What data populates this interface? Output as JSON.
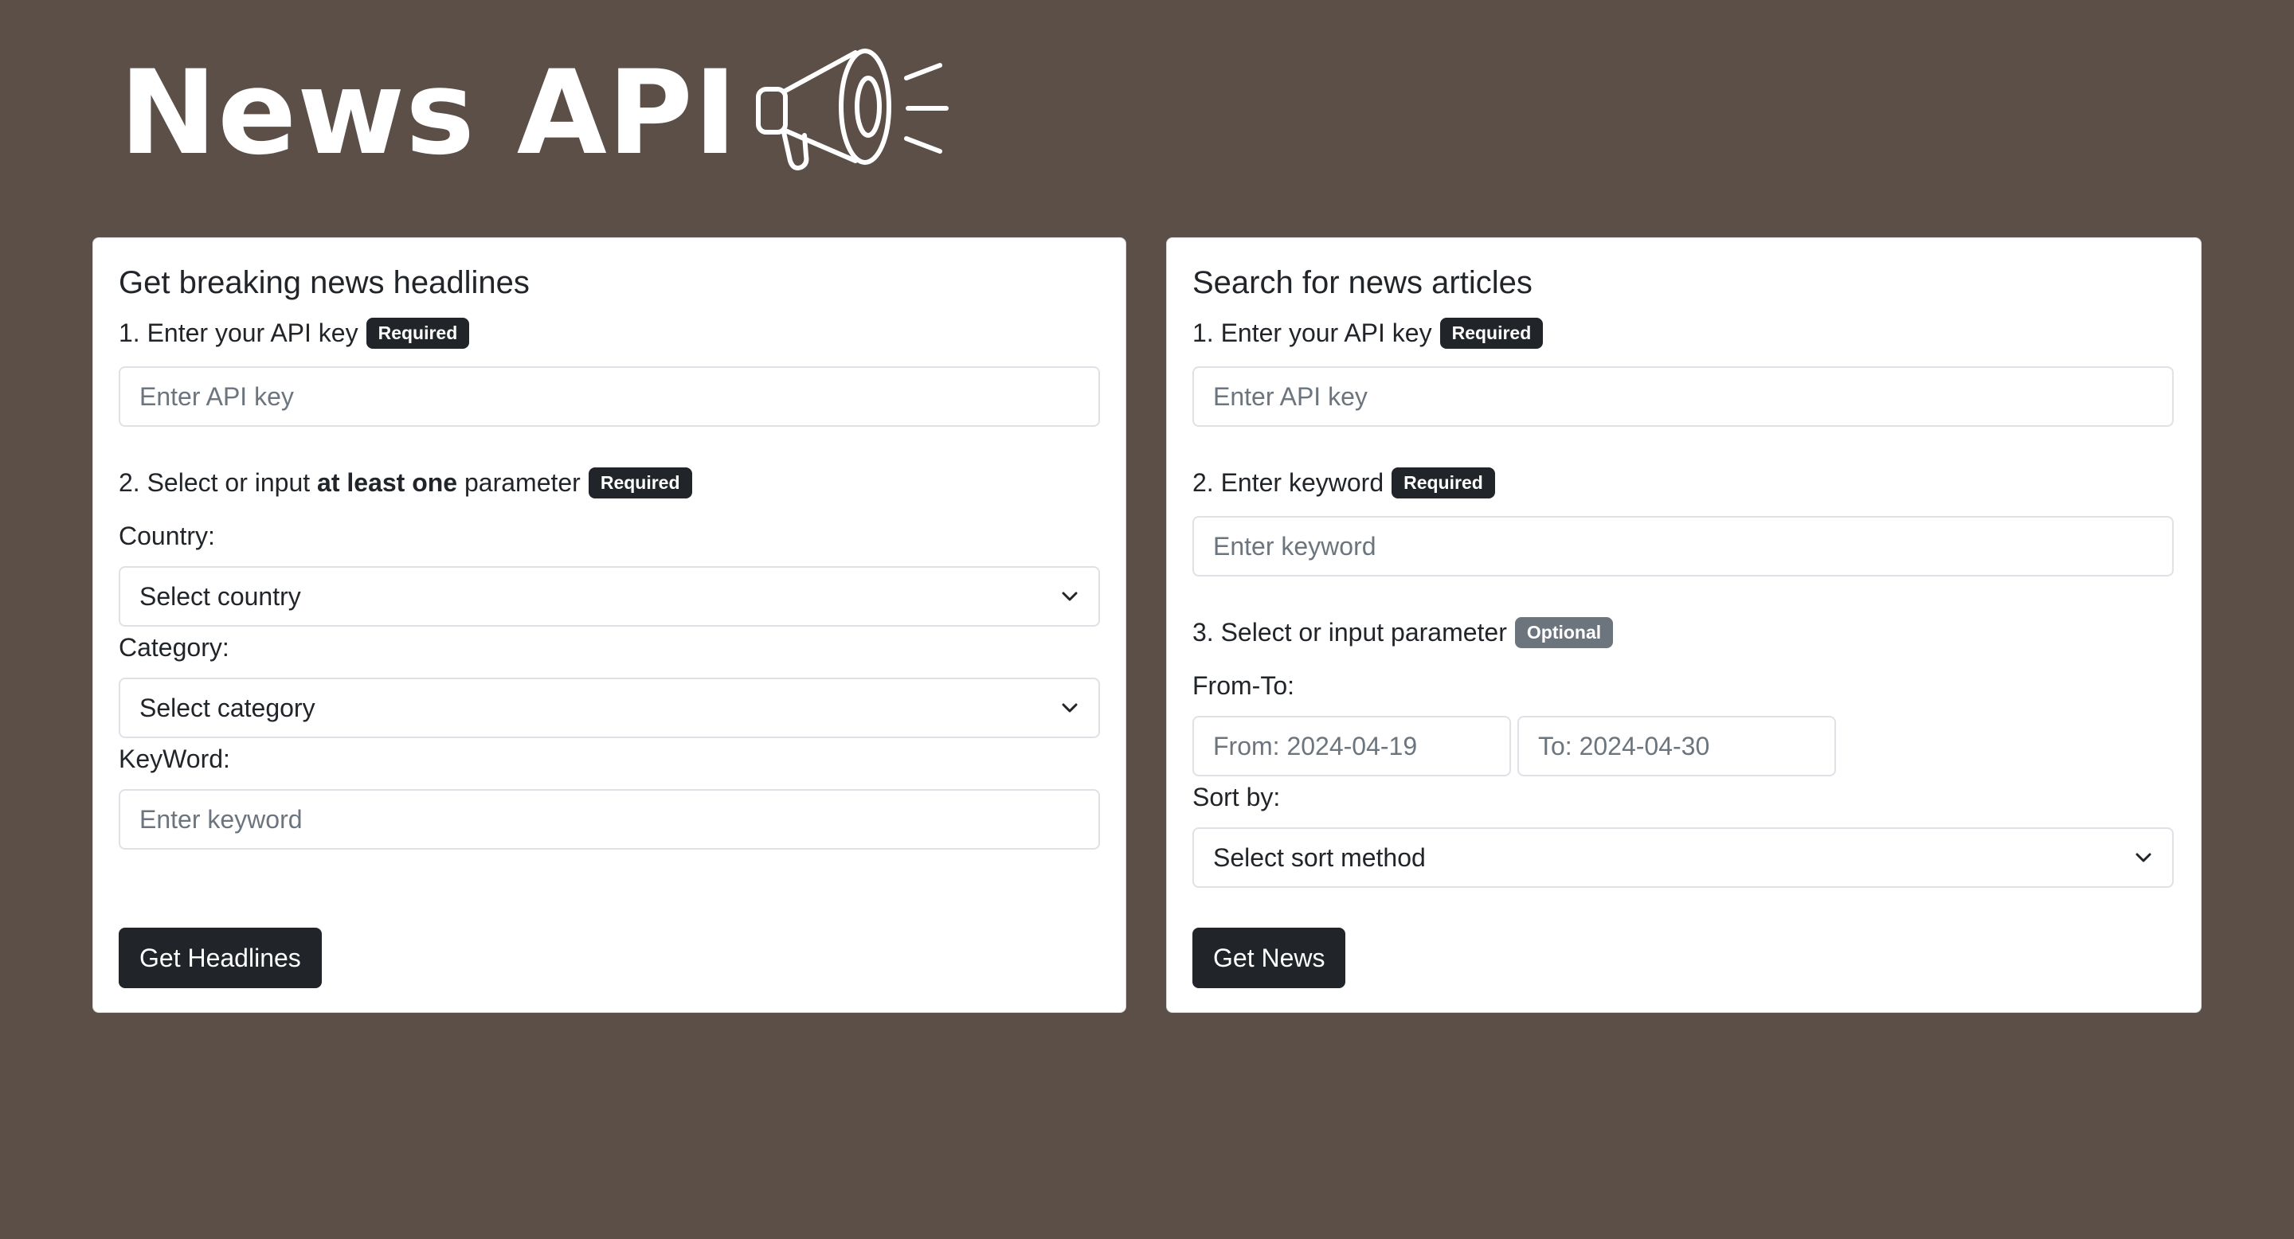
{
  "logo": {
    "text": "News API",
    "icon": "megaphone-icon"
  },
  "headlines": {
    "title": "Get breaking news headlines",
    "step1_label": "1. Enter your API key",
    "step1_badge": "Required",
    "api_key_placeholder": "Enter API key",
    "step2_prefix": "2. Select or input ",
    "step2_bold": "at least one",
    "step2_suffix": " parameter",
    "step2_badge": "Required",
    "country_label": "Country:",
    "country_value": "Select country",
    "category_label": "Category:",
    "category_value": "Select category",
    "keyword_label": "KeyWord:",
    "keyword_placeholder": "Enter keyword",
    "submit_label": "Get Headlines"
  },
  "articles": {
    "title": "Search for news articles",
    "step1_label": "1. Enter your API key",
    "step1_badge": "Required",
    "api_key_placeholder": "Enter API key",
    "step2_label": "2. Enter keyword",
    "step2_badge": "Required",
    "keyword_placeholder": "Enter keyword",
    "step3_label": "3. Select or input parameter",
    "step3_badge": "Optional",
    "fromto_label": "From-To:",
    "from_placeholder": "From: 2024-04-19",
    "to_placeholder": "To: 2024-04-30",
    "sortby_label": "Sort by:",
    "sortby_value": "Select sort method",
    "submit_label": "Get News"
  },
  "colors": {
    "background": "#5b4f48",
    "button": "#212529",
    "badge_required": "#212529",
    "badge_optional": "#6c757d"
  }
}
